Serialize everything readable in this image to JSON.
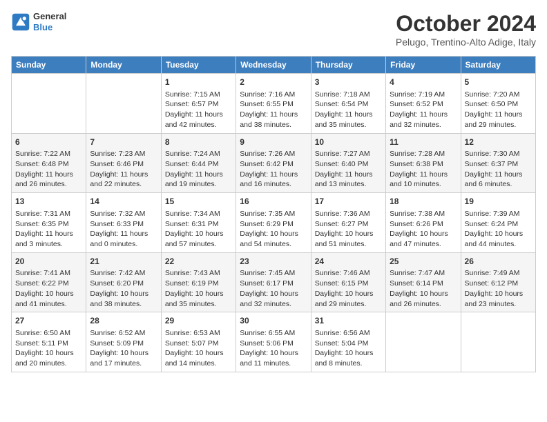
{
  "header": {
    "logo_line1": "General",
    "logo_line2": "Blue",
    "title": "October 2024",
    "subtitle": "Pelugo, Trentino-Alto Adige, Italy"
  },
  "columns": [
    "Sunday",
    "Monday",
    "Tuesday",
    "Wednesday",
    "Thursday",
    "Friday",
    "Saturday"
  ],
  "weeks": [
    [
      {
        "day": "",
        "content": ""
      },
      {
        "day": "",
        "content": ""
      },
      {
        "day": "1",
        "content": "Sunrise: 7:15 AM\nSunset: 6:57 PM\nDaylight: 11 hours and 42 minutes."
      },
      {
        "day": "2",
        "content": "Sunrise: 7:16 AM\nSunset: 6:55 PM\nDaylight: 11 hours and 38 minutes."
      },
      {
        "day": "3",
        "content": "Sunrise: 7:18 AM\nSunset: 6:54 PM\nDaylight: 11 hours and 35 minutes."
      },
      {
        "day": "4",
        "content": "Sunrise: 7:19 AM\nSunset: 6:52 PM\nDaylight: 11 hours and 32 minutes."
      },
      {
        "day": "5",
        "content": "Sunrise: 7:20 AM\nSunset: 6:50 PM\nDaylight: 11 hours and 29 minutes."
      }
    ],
    [
      {
        "day": "6",
        "content": "Sunrise: 7:22 AM\nSunset: 6:48 PM\nDaylight: 11 hours and 26 minutes."
      },
      {
        "day": "7",
        "content": "Sunrise: 7:23 AM\nSunset: 6:46 PM\nDaylight: 11 hours and 22 minutes."
      },
      {
        "day": "8",
        "content": "Sunrise: 7:24 AM\nSunset: 6:44 PM\nDaylight: 11 hours and 19 minutes."
      },
      {
        "day": "9",
        "content": "Sunrise: 7:26 AM\nSunset: 6:42 PM\nDaylight: 11 hours and 16 minutes."
      },
      {
        "day": "10",
        "content": "Sunrise: 7:27 AM\nSunset: 6:40 PM\nDaylight: 11 hours and 13 minutes."
      },
      {
        "day": "11",
        "content": "Sunrise: 7:28 AM\nSunset: 6:38 PM\nDaylight: 11 hours and 10 minutes."
      },
      {
        "day": "12",
        "content": "Sunrise: 7:30 AM\nSunset: 6:37 PM\nDaylight: 11 hours and 6 minutes."
      }
    ],
    [
      {
        "day": "13",
        "content": "Sunrise: 7:31 AM\nSunset: 6:35 PM\nDaylight: 11 hours and 3 minutes."
      },
      {
        "day": "14",
        "content": "Sunrise: 7:32 AM\nSunset: 6:33 PM\nDaylight: 11 hours and 0 minutes."
      },
      {
        "day": "15",
        "content": "Sunrise: 7:34 AM\nSunset: 6:31 PM\nDaylight: 10 hours and 57 minutes."
      },
      {
        "day": "16",
        "content": "Sunrise: 7:35 AM\nSunset: 6:29 PM\nDaylight: 10 hours and 54 minutes."
      },
      {
        "day": "17",
        "content": "Sunrise: 7:36 AM\nSunset: 6:27 PM\nDaylight: 10 hours and 51 minutes."
      },
      {
        "day": "18",
        "content": "Sunrise: 7:38 AM\nSunset: 6:26 PM\nDaylight: 10 hours and 47 minutes."
      },
      {
        "day": "19",
        "content": "Sunrise: 7:39 AM\nSunset: 6:24 PM\nDaylight: 10 hours and 44 minutes."
      }
    ],
    [
      {
        "day": "20",
        "content": "Sunrise: 7:41 AM\nSunset: 6:22 PM\nDaylight: 10 hours and 41 minutes."
      },
      {
        "day": "21",
        "content": "Sunrise: 7:42 AM\nSunset: 6:20 PM\nDaylight: 10 hours and 38 minutes."
      },
      {
        "day": "22",
        "content": "Sunrise: 7:43 AM\nSunset: 6:19 PM\nDaylight: 10 hours and 35 minutes."
      },
      {
        "day": "23",
        "content": "Sunrise: 7:45 AM\nSunset: 6:17 PM\nDaylight: 10 hours and 32 minutes."
      },
      {
        "day": "24",
        "content": "Sunrise: 7:46 AM\nSunset: 6:15 PM\nDaylight: 10 hours and 29 minutes."
      },
      {
        "day": "25",
        "content": "Sunrise: 7:47 AM\nSunset: 6:14 PM\nDaylight: 10 hours and 26 minutes."
      },
      {
        "day": "26",
        "content": "Sunrise: 7:49 AM\nSunset: 6:12 PM\nDaylight: 10 hours and 23 minutes."
      }
    ],
    [
      {
        "day": "27",
        "content": "Sunrise: 6:50 AM\nSunset: 5:11 PM\nDaylight: 10 hours and 20 minutes."
      },
      {
        "day": "28",
        "content": "Sunrise: 6:52 AM\nSunset: 5:09 PM\nDaylight: 10 hours and 17 minutes."
      },
      {
        "day": "29",
        "content": "Sunrise: 6:53 AM\nSunset: 5:07 PM\nDaylight: 10 hours and 14 minutes."
      },
      {
        "day": "30",
        "content": "Sunrise: 6:55 AM\nSunset: 5:06 PM\nDaylight: 10 hours and 11 minutes."
      },
      {
        "day": "31",
        "content": "Sunrise: 6:56 AM\nSunset: 5:04 PM\nDaylight: 10 hours and 8 minutes."
      },
      {
        "day": "",
        "content": ""
      },
      {
        "day": "",
        "content": ""
      }
    ]
  ]
}
